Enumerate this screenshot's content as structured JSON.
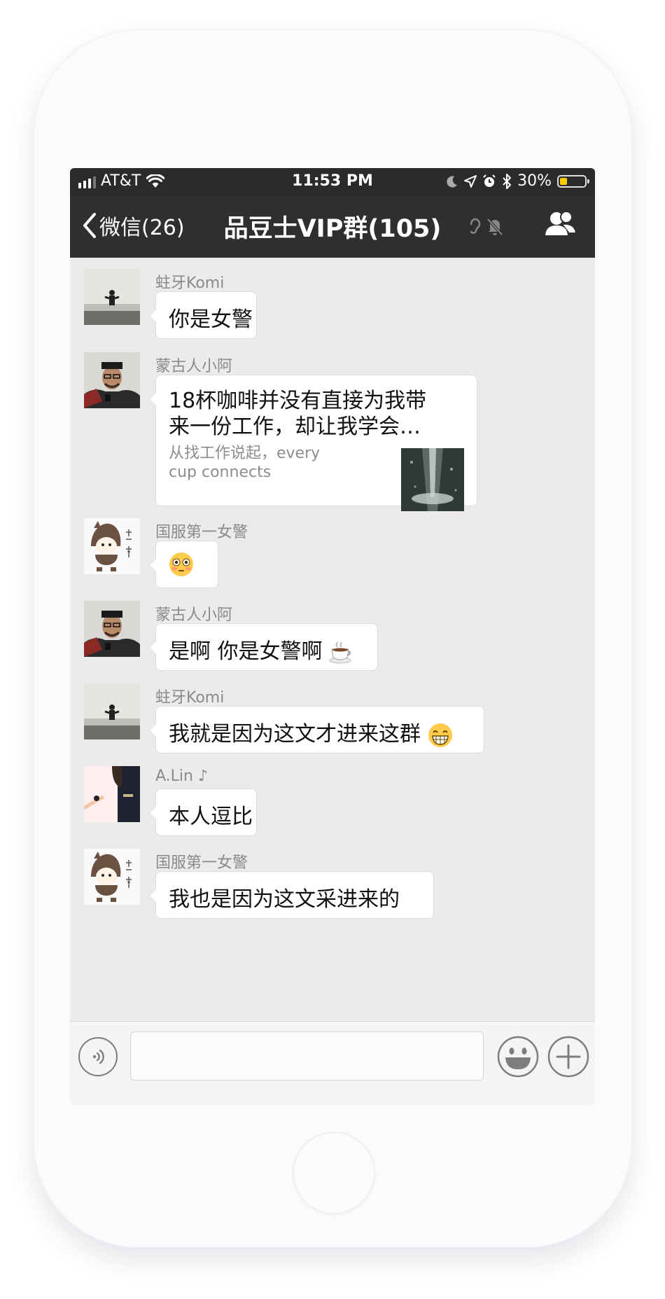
{
  "status_bar": {
    "carrier": "AT&T",
    "time": "11:53 PM",
    "battery": "30%",
    "battery_level": 0.3
  },
  "nav": {
    "back_label": "微信(26)",
    "title": "品豆士VIP群(105)"
  },
  "messages": [
    {
      "sender": "蛀牙Komi",
      "text": "你是女警"
    },
    {
      "sender": "蒙古人小阿",
      "card_title": "18杯咖啡并没有直接为我带来一份工作，却让我学会…",
      "card_desc": "从找工作说起，every cup connects"
    },
    {
      "sender": "国服第一女警",
      "emoji": "flushed-face"
    },
    {
      "sender": "蒙古人小阿",
      "text": "是啊 你是女警啊",
      "emoji": "hot-beverage"
    },
    {
      "sender": "蛀牙Komi",
      "text": "我就是因为这文才进来这群",
      "emoji": "grinning-face"
    },
    {
      "sender": "A.Lin ♪",
      "text": "本人逗比"
    },
    {
      "sender": "国服第一女警",
      "text": "我也是因为这文采进来的"
    }
  ],
  "input": {
    "value": "",
    "placeholder": ""
  },
  "colors": {
    "bar": "#2f2f32",
    "chat_bg": "#ebebeb",
    "bubble": "#ffffff",
    "battery": "#ffcc00"
  }
}
